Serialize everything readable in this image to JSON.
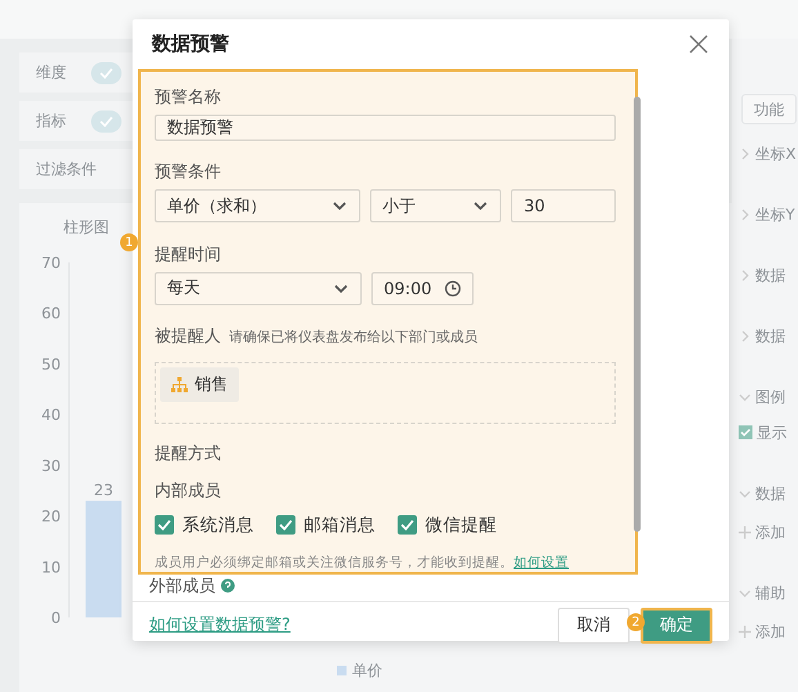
{
  "background": {
    "left_panel": {
      "fields": [
        {
          "label": "维度",
          "kind": "pill"
        },
        {
          "label": "指标",
          "kind": "pill"
        },
        {
          "label": "过滤条件",
          "kind": "plain"
        }
      ]
    },
    "chart": {
      "chart_data": {
        "type": "bar",
        "title": "柱形图",
        "series": [
          {
            "name": "单价",
            "color": "#c9dcf0",
            "values": [
              23
            ]
          }
        ],
        "ylim": [
          0,
          70
        ],
        "yticks": [
          0,
          10,
          20,
          30,
          40,
          50,
          60,
          70
        ],
        "data_labels": true
      }
    },
    "right_panel": {
      "button": "功能",
      "items": [
        {
          "label": "坐标X",
          "kind": "section",
          "expanded": false
        },
        {
          "label": "坐标Y",
          "kind": "section",
          "expanded": false
        },
        {
          "label": "数据",
          "kind": "section",
          "expanded": false
        },
        {
          "label": "数据",
          "kind": "section",
          "expanded": false
        },
        {
          "label": "图例",
          "kind": "section",
          "expanded": true
        },
        {
          "label": "显示",
          "kind": "checkbox",
          "checked": true
        },
        {
          "label": "数据",
          "kind": "section",
          "expanded": true
        },
        {
          "label": "添加",
          "kind": "add"
        },
        {
          "label": "辅助",
          "kind": "section",
          "expanded": true
        },
        {
          "label": "添加",
          "kind": "add"
        }
      ]
    }
  },
  "dialog": {
    "title": "数据预警",
    "name": {
      "label": "预警名称",
      "value": "数据预警"
    },
    "condition": {
      "label": "预警条件",
      "field": "单价（求和）",
      "operator": "小于",
      "value": "30"
    },
    "time": {
      "label": "提醒时间",
      "frequency": "每天",
      "value": "09:00"
    },
    "recipients": {
      "label": "被提醒人",
      "hint": "请确保已将仪表盘发布给以下部门或成员",
      "tags": [
        {
          "label": "销售"
        }
      ]
    },
    "method": {
      "label": "提醒方式",
      "group": "内部成员",
      "options": [
        {
          "label": "系统消息",
          "checked": true
        },
        {
          "label": "邮箱消息",
          "checked": true
        },
        {
          "label": "微信提醒",
          "checked": true
        }
      ],
      "note": "成员用户必须绑定邮箱或关注微信服务号，才能收到提醒。",
      "note_link": "如何设置",
      "external": "外部成员"
    },
    "help_link": "如何设置数据预警?",
    "buttons": [
      {
        "label": "取消",
        "kind": "secondary"
      },
      {
        "label": "确定",
        "kind": "primary"
      }
    ],
    "callouts": [
      "1",
      "2"
    ]
  }
}
